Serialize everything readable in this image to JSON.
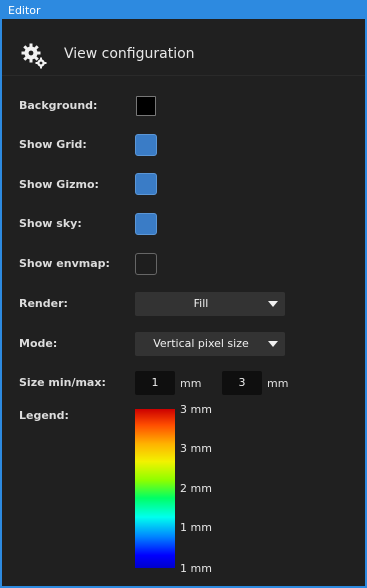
{
  "window": {
    "title": "Editor",
    "accent_color": "#2d8ae0"
  },
  "header": {
    "icon": "gear-icon",
    "title": "View configuration"
  },
  "fields": {
    "background_label": "Background:",
    "background_color": "#000000",
    "show_grid_label": "Show Grid:",
    "show_grid_checked": true,
    "show_gizmo_label": "Show Gizmo:",
    "show_gizmo_checked": true,
    "show_sky_label": "Show sky:",
    "show_sky_checked": true,
    "show_envmap_label": "Show envmap:",
    "show_envmap_checked": false,
    "render_label": "Render:",
    "render_value": "Fill",
    "mode_label": "Mode:",
    "mode_value": "Vertical pixel size",
    "size_label": "Size min/max:",
    "size_min": "1",
    "size_min_unit": "mm",
    "size_max": "3",
    "size_max_unit": "mm",
    "legend_label": "Legend:"
  },
  "legend": {
    "ticks": [
      "3 mm",
      "3 mm",
      "2 mm",
      "1 mm",
      "1 mm"
    ]
  }
}
